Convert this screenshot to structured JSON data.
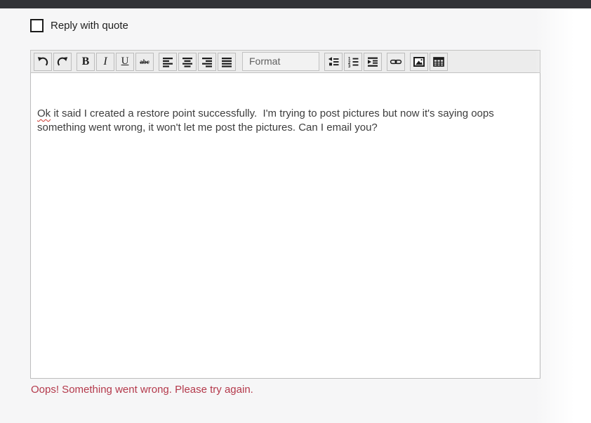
{
  "topbar": {
    "color": "#333438"
  },
  "reply_with_quote": {
    "label": "Reply with quote",
    "checked": false
  },
  "toolbar": {
    "buttons": [
      "undo",
      "redo",
      "bold",
      "italic",
      "underline",
      "strikethrough",
      "align-left",
      "align-center",
      "align-right",
      "justify",
      "format",
      "bullet-list",
      "numbered-list",
      "indent",
      "link",
      "image",
      "table"
    ],
    "bold_label": "B",
    "italic_label": "I",
    "underline_label": "U",
    "strikethrough_label": "abc",
    "format_dropdown": {
      "value": "Format"
    }
  },
  "editor": {
    "misspelled_word": "Ok",
    "line1_rest": " it said I created a restore point successfully.  I'm trying to post pictures but now it's saying oops",
    "line2": "something went wrong, it won't let me post the pictures. Can I email you?"
  },
  "error": {
    "message": "Oops! Something went wrong. Please try again.",
    "color": "#b4394b"
  },
  "colors": {
    "page_background": "#f6f6f7",
    "toolbar_background": "#ececec",
    "editor_background": "#ffffff",
    "text": "#3d3d3d",
    "error_text": "#b4394b",
    "topbar": "#333438"
  }
}
